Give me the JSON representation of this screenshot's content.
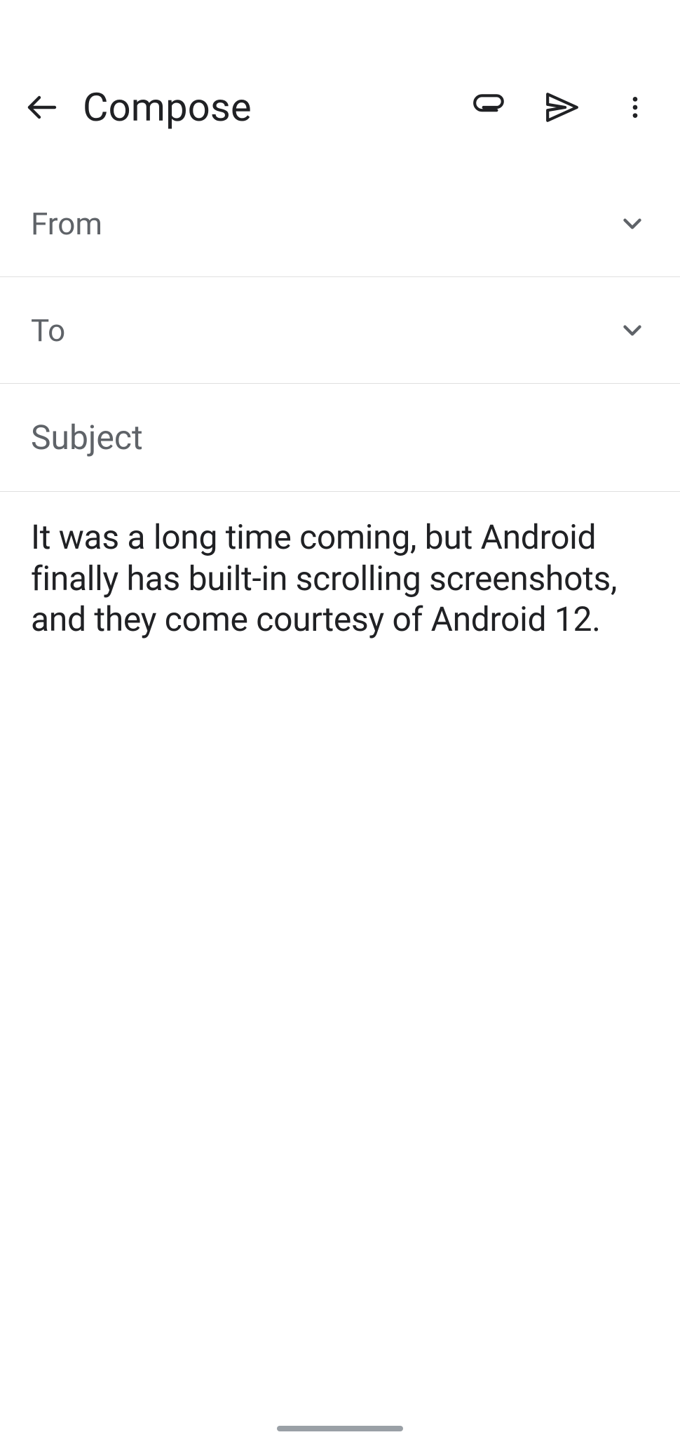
{
  "header": {
    "title": "Compose"
  },
  "fields": {
    "from_label": "From",
    "to_label": "To",
    "subject_placeholder": "Subject",
    "subject_value": ""
  },
  "body": {
    "text": "It was a long time coming, but Android finally has built-in scrolling screenshots, and they come courtesy of Android 12."
  }
}
